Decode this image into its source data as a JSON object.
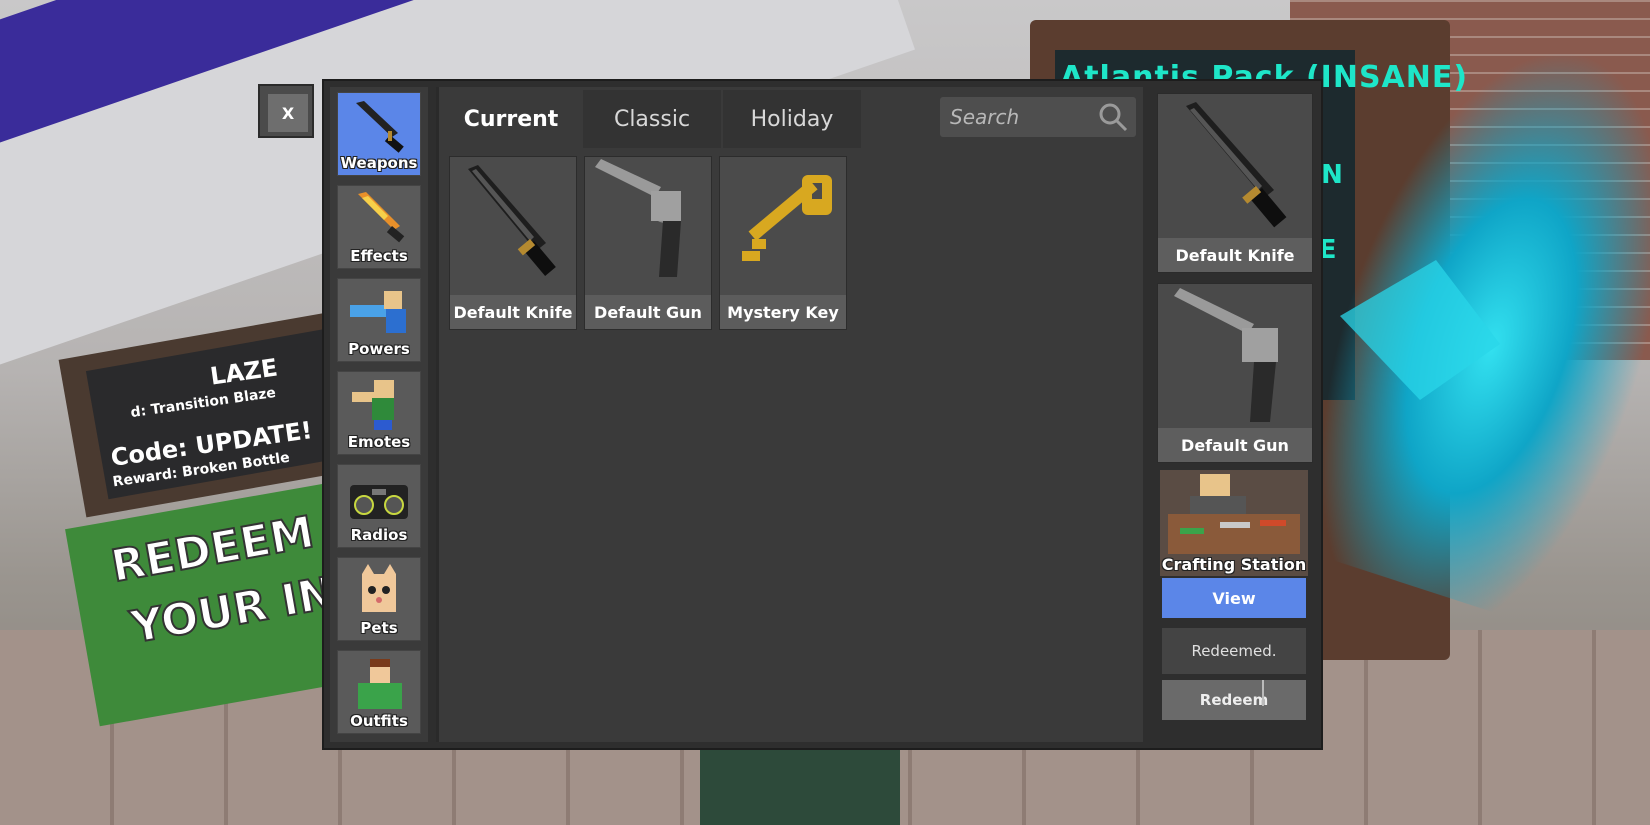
{
  "close_button": {
    "label": "X"
  },
  "categories": [
    {
      "label": "Weapons",
      "icon": "knife-icon",
      "active": true
    },
    {
      "label": "Effects",
      "icon": "flame-icon",
      "active": false
    },
    {
      "label": "Powers",
      "icon": "power-icon",
      "active": false
    },
    {
      "label": "Emotes",
      "icon": "emote-icon",
      "active": false
    },
    {
      "label": "Radios",
      "icon": "radio-icon",
      "active": false
    },
    {
      "label": "Pets",
      "icon": "pet-icon",
      "active": false
    },
    {
      "label": "Outfits",
      "icon": "outfit-icon",
      "active": false
    }
  ],
  "tabs": [
    {
      "label": "Current",
      "active": true
    },
    {
      "label": "Classic",
      "active": false
    },
    {
      "label": "Holiday",
      "active": false
    }
  ],
  "search": {
    "placeholder": "Search"
  },
  "items": [
    {
      "label": "Default Knife",
      "icon": "knife-icon"
    },
    {
      "label": "Default Gun",
      "icon": "revolver-icon"
    },
    {
      "label": "Mystery Key",
      "icon": "key-icon"
    }
  ],
  "equipped": [
    {
      "label": "Default Knife",
      "icon": "knife-icon"
    },
    {
      "label": "Default Gun",
      "icon": "revolver-icon"
    }
  ],
  "crafting": {
    "label": "Crafting Station",
    "view_label": "View"
  },
  "redeem": {
    "status": "Redeemed.",
    "button_label": "Redeem"
  },
  "background": {
    "board_left_line1": "LAZE",
    "board_left_line2": "d: Transition Blaze",
    "board_left_line3": "Code: UPDATE!",
    "board_left_line4": "Reward: Broken Bottle",
    "banner_line1": "REDEEM C",
    "banner_line2": "YOUR IN",
    "neon_line1": "Atlantis Pack (INSANE)",
    "neon_line2": "UN",
    "neon_line3": "SE"
  },
  "colors": {
    "accent": "#5b86e8",
    "panel": "#2e2e2e",
    "tile": "#4b4b4b",
    "neon": "#1ee6c8"
  }
}
